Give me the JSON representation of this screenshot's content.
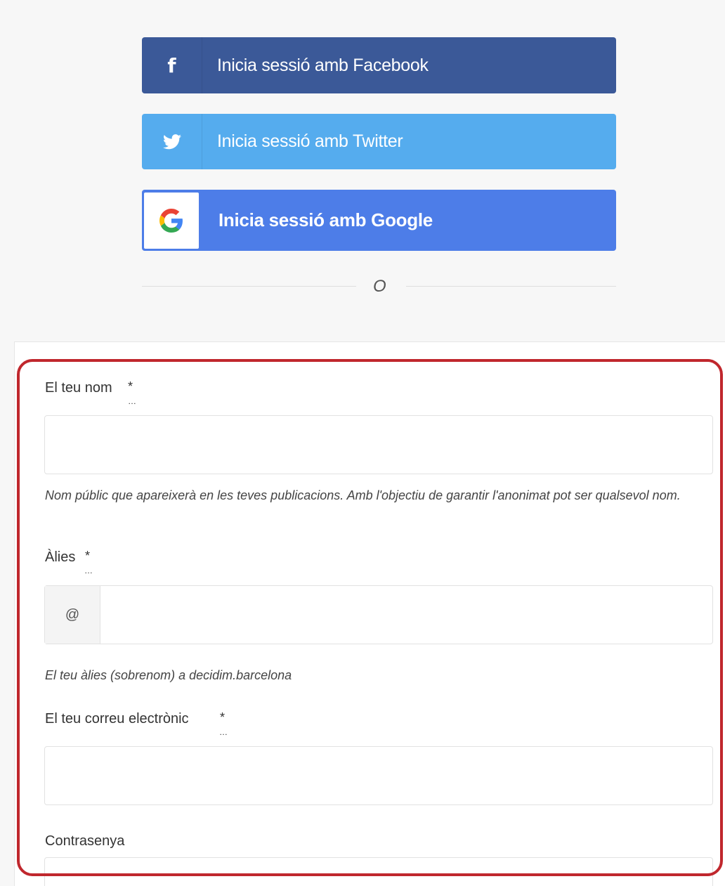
{
  "social": {
    "facebook_label": "Inicia sessió amb Facebook",
    "twitter_label": "Inicia sessió amb Twitter",
    "google_label": "Inicia sessió amb Google",
    "facebook_icon": "facebook-f-icon",
    "twitter_icon": "twitter-bird-icon",
    "google_icon": "google-g-icon",
    "colors": {
      "facebook": "#3b5998",
      "twitter": "#55acee",
      "google": "#4d7de8"
    }
  },
  "divider": {
    "text": "O"
  },
  "form": {
    "name": {
      "label": "El teu nom",
      "required_mark": "*",
      "value": "",
      "help": "Nom públic que apareixerà en les teves publicacions. Amb l'objectiu de garantir l'anonimat pot ser qualsevol nom."
    },
    "alias": {
      "label": "Àlies",
      "required_mark": "*",
      "prefix": "@",
      "value": "",
      "help": "El teu àlies (sobrenom) a decidim.barcelona"
    },
    "email": {
      "label": "El teu correu electrònic",
      "required_mark": "*",
      "value": ""
    },
    "password": {
      "label": "Contrasenya",
      "value": ""
    }
  },
  "highlight_color": "#c0272d"
}
